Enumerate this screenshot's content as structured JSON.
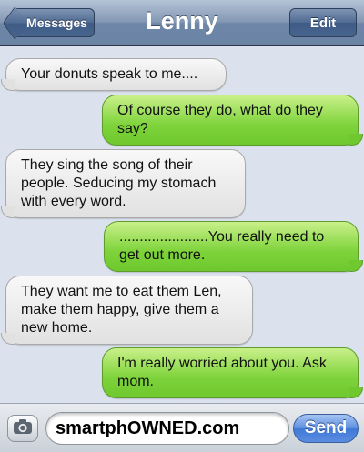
{
  "header": {
    "back_label": "Messages",
    "title": "Lenny",
    "edit_label": "Edit"
  },
  "messages": [
    {
      "direction": "incoming",
      "text": "Your donuts speak to me...."
    },
    {
      "direction": "outgoing",
      "text": "Of course they do, what do they say?"
    },
    {
      "direction": "incoming",
      "text": "They sing the song of their people. Seducing my stomach with every word."
    },
    {
      "direction": "outgoing",
      "text": "......................You really need to get out more."
    },
    {
      "direction": "incoming",
      "text": "They want me to eat them Len, make them happy, give them a new home."
    },
    {
      "direction": "outgoing",
      "text": "I'm really worried about you. Ask mom."
    }
  ],
  "input": {
    "value": "smartphOWNED.com",
    "camera_icon": "camera-icon",
    "send_label": "Send"
  },
  "colors": {
    "incoming_bubble": "#e6e6e6",
    "outgoing_bubble": "#7ed33b",
    "navbar": "#6e86a7",
    "send_button": "#3f78d6",
    "background": "#dbe2ed"
  }
}
